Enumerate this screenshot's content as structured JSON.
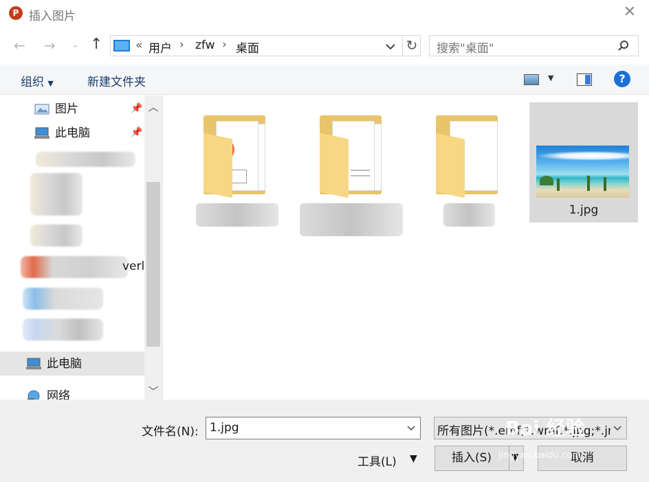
{
  "window": {
    "title": "插入图片",
    "app_icon_letter": "P"
  },
  "nav": {
    "path": [
      "用户",
      "zfw",
      "桌面"
    ],
    "path_prefix": "«",
    "search_placeholder": "搜索\"桌面\""
  },
  "toolbar": {
    "organize": "组织",
    "new_folder": "新建文件夹"
  },
  "sidebar": {
    "items": [
      {
        "label": "图片"
      },
      {
        "label": "此电脑"
      },
      {
        "label": "此电脑"
      },
      {
        "label": "网络"
      }
    ],
    "partial_text": "verl"
  },
  "files": [
    {
      "label": "1.jpg"
    }
  ],
  "bottom": {
    "filename_label": "文件名(N):",
    "filename_value": "1.jpg",
    "filetype_value": "所有图片(*.emf;*.wmf;*.jpg;*.jr",
    "tools_label": "工具(L)",
    "insert_label": "插入(S)",
    "cancel_label": "取消"
  },
  "watermark": {
    "main": "Bai 经验",
    "url": "jingyan.baidu.com"
  },
  "colors": {
    "accent": "#1a6fd8",
    "selection": "#d9d9d9",
    "ppt_brand": "#c43e1c"
  }
}
